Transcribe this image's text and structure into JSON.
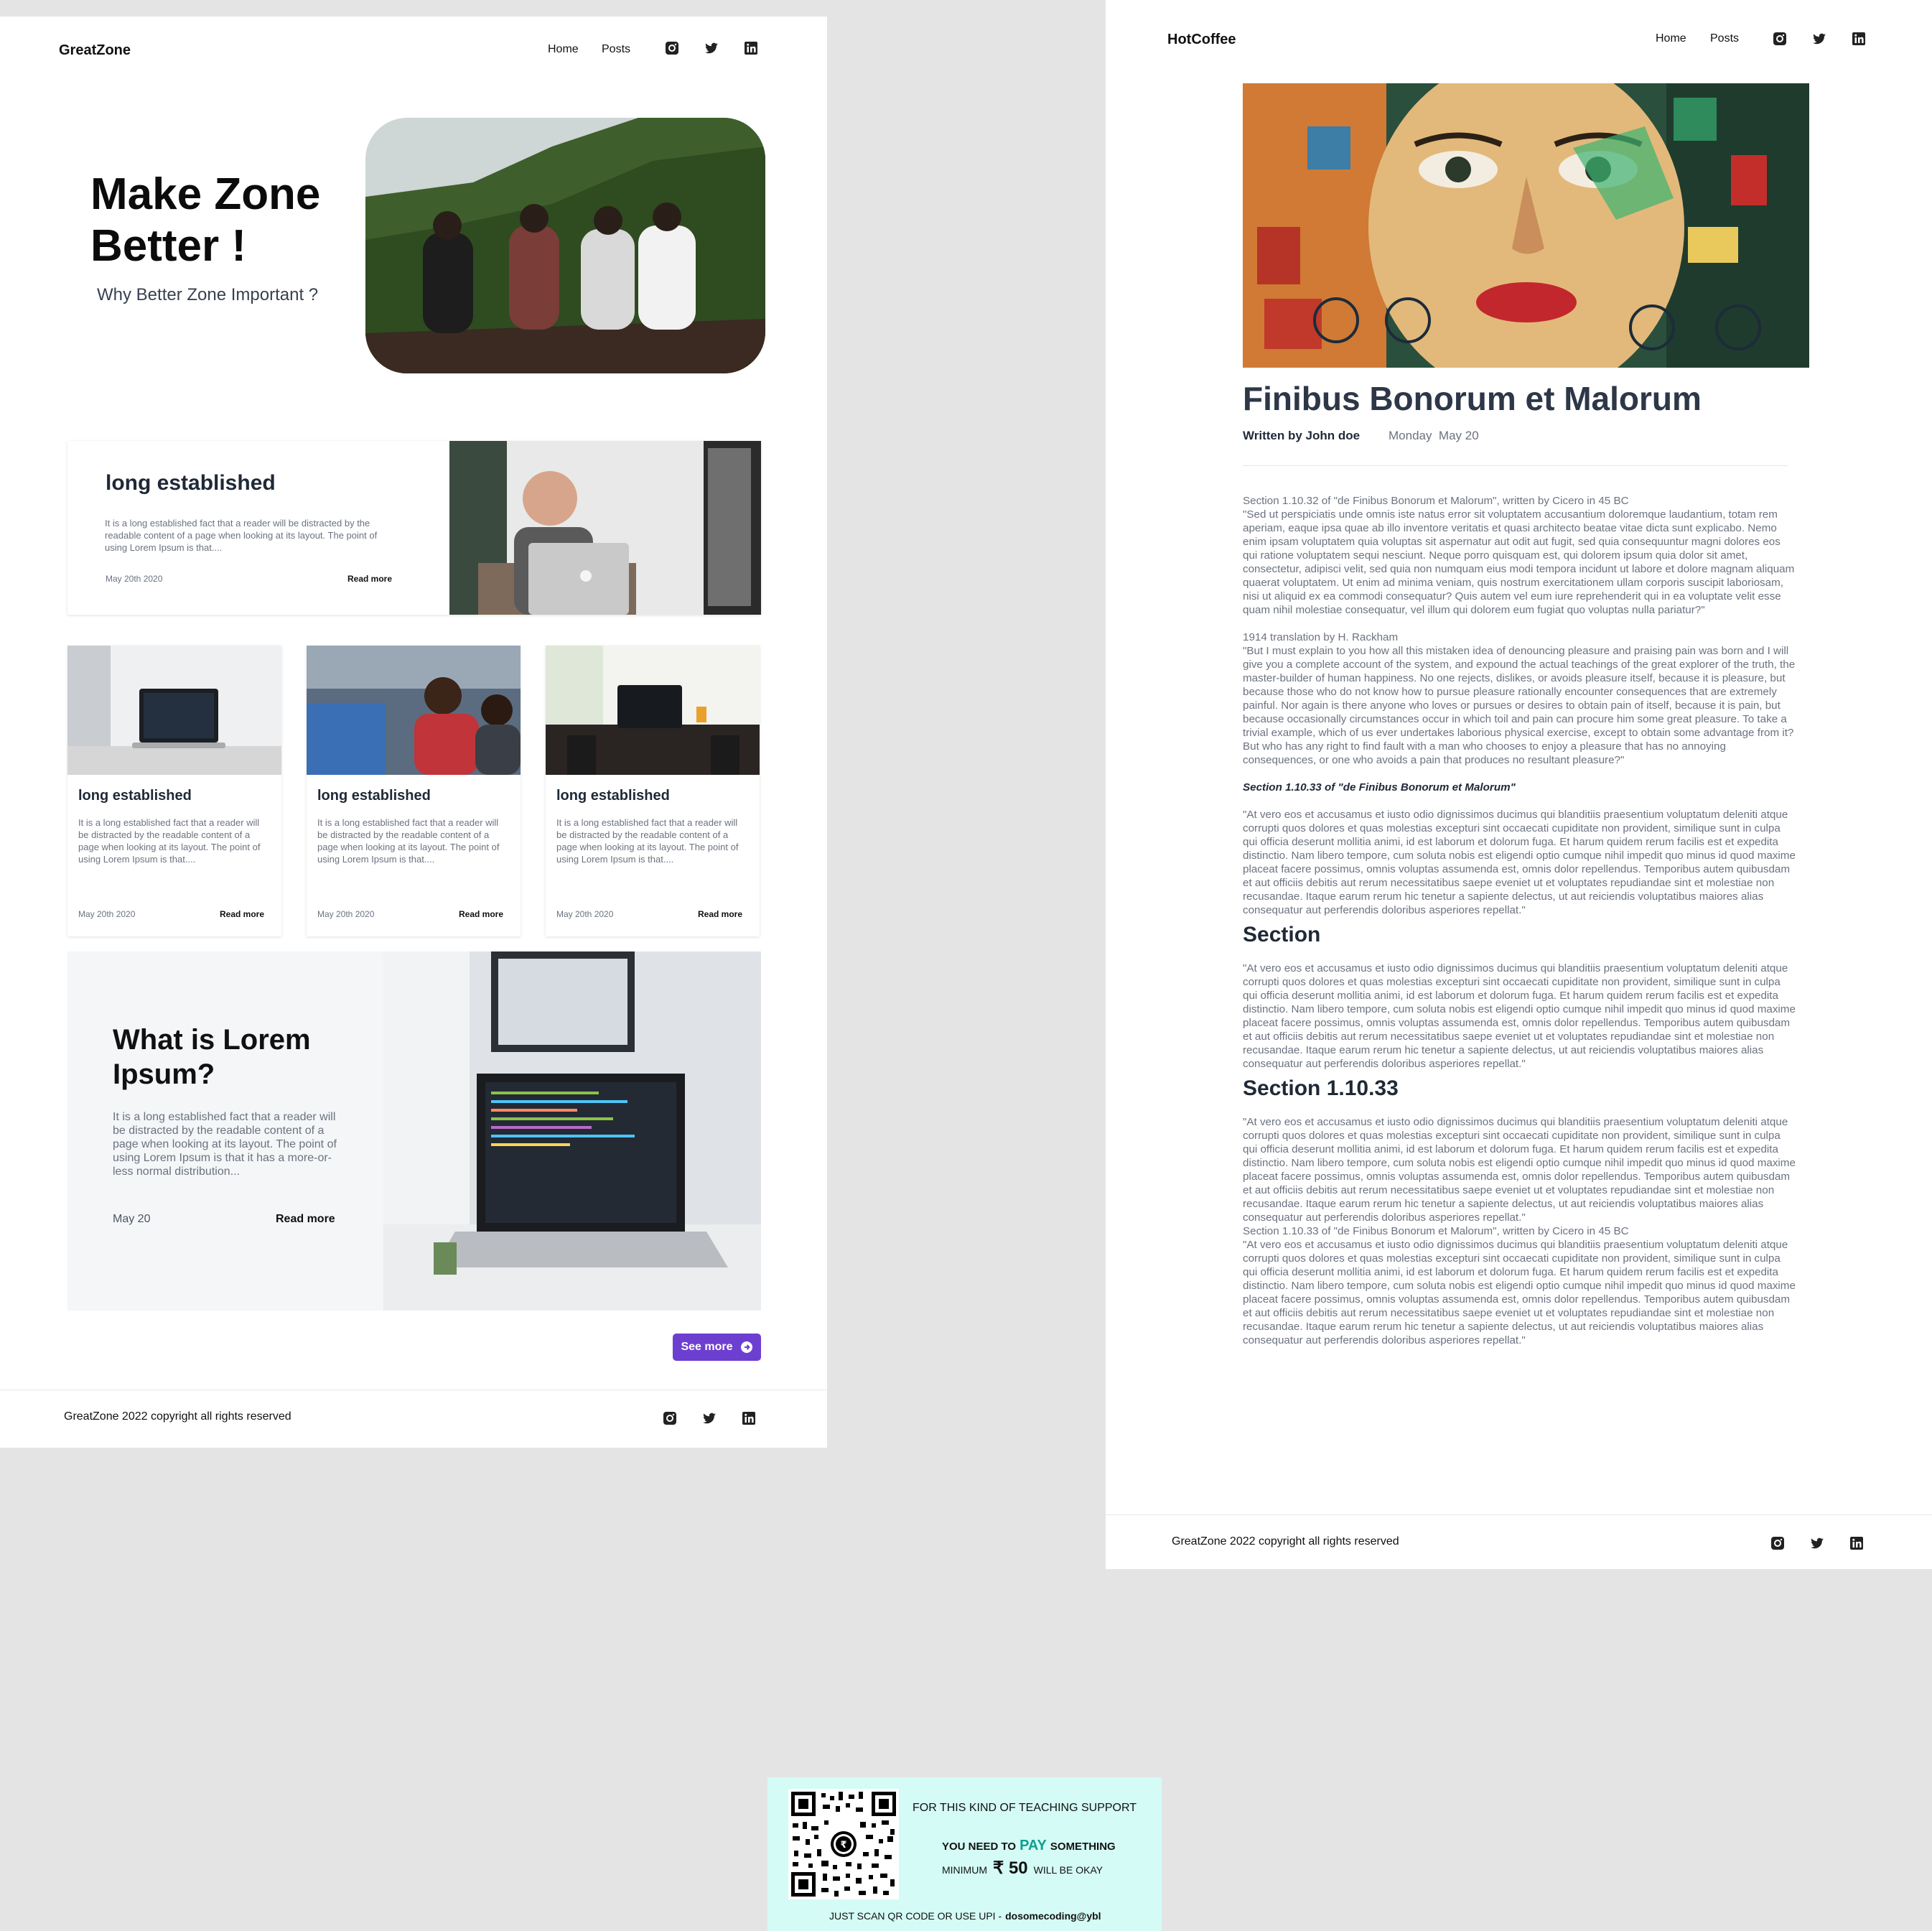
{
  "left_page": {
    "brand": "GreatZone",
    "nav": {
      "home": "Home",
      "posts": "Posts"
    },
    "social": [
      "instagram-icon",
      "twitter-icon",
      "linkedin-icon"
    ],
    "hero": {
      "title_line1": "Make Zone",
      "title_line2": "Better !",
      "subtitle": "Why Better Zone Important ?"
    },
    "featured": {
      "title": "long established",
      "text": "It is a long established fact that a reader will be distracted by the readable content of a page when looking at its layout. The point of using Lorem Ipsum is that....",
      "date": "May 20th 2020",
      "read_more": "Read more"
    },
    "cards": [
      {
        "title": "long established",
        "text": "It is a long established fact that a reader will be distracted by the readable content of a page when looking at its layout. The point of using Lorem Ipsum is that....",
        "date": "May 20th 2020",
        "read_more": "Read more"
      },
      {
        "title": "long established",
        "text": "It is a long established fact that a reader will be distracted by the readable content of a page when looking at its layout. The point of using Lorem Ipsum is that....",
        "date": "May 20th 2020",
        "read_more": "Read more"
      },
      {
        "title": "long established",
        "text": "It is a long established fact that a reader will be distracted by the readable content of a page when looking at its layout. The point of using Lorem Ipsum is that....",
        "date": "May 20th 2020",
        "read_more": "Read more"
      }
    ],
    "lorem": {
      "title_line1": "What is Lorem",
      "title_line2": "Ipsum?",
      "text": "It is a long established fact that a reader will be distracted by the readable content of a page when looking at its layout. The point of using Lorem Ipsum is that it has a more-or-less normal distribution...",
      "date": "May 20",
      "read_more": "Read more"
    },
    "see_more": "See more",
    "footer": "GreatZone 2022 copyright all rights reserved",
    "accent": "#6d3fd1"
  },
  "right_page": {
    "brand": "HotCoffee",
    "nav": {
      "home": "Home",
      "posts": "Posts"
    },
    "article": {
      "title": "Finibus Bonorum et Malorum",
      "author": "Written by John doe",
      "date": "Monday  May 20",
      "p1_head": "Section 1.10.32 of \"de Finibus Bonorum et Malorum\", written by Cicero in 45 BC",
      "p1": "\"Sed ut perspiciatis unde omnis iste natus error sit voluptatem accusantium doloremque laudantium, totam rem aperiam, eaque ipsa quae ab illo inventore veritatis et quasi architecto beatae vitae dicta sunt explicabo. Nemo enim ipsam voluptatem quia voluptas sit aspernatur aut odit aut fugit, sed quia consequuntur magni dolores eos qui ratione voluptatem sequi nesciunt. Neque porro quisquam est, qui dolorem ipsum quia dolor sit amet, consectetur, adipisci velit, sed quia non numquam eius modi tempora incidunt ut labore et dolore magnam aliquam quaerat voluptatem. Ut enim ad minima veniam, quis nostrum exercitationem ullam corporis suscipit laboriosam, nisi ut aliquid ex ea commodi consequatur? Quis autem vel eum iure reprehenderit qui in ea voluptate velit esse quam nihil molestiae consequatur, vel illum qui dolorem eum fugiat quo voluptas nulla pariatur?\"",
      "p2_head": "1914 translation by H. Rackham",
      "p2": "\"But I must explain to you how all this mistaken idea of denouncing pleasure and praising pain was born and I will give you a complete account of the system, and expound the actual teachings of the great explorer of the truth, the master-builder of human happiness. No one rejects, dislikes, or avoids pleasure itself, because it is pleasure, but because those who do not know how to pursue pleasure rationally encounter consequences that are extremely painful. Nor again is there anyone who loves or pursues or desires to obtain pain of itself, because it is pain, but because occasionally circumstances occur in which toil and pain can procure him some great pleasure. To take a trivial example, which of us ever undertakes laborious physical exercise, except to obtain some advantage from it? But who has any right to find fault with a man who chooses to enjoy a pleasure that has no annoying consequences, or one who avoids a pain that produces no resultant pleasure?\"",
      "italic_head": "Section 1.10.33 of \"de Finibus Bonorum et Malorum\"",
      "p3": "\"At vero eos et accusamus et iusto odio dignissimos ducimus qui blanditiis praesentium voluptatum deleniti atque corrupti quos dolores et quas molestias excepturi sint occaecati cupiditate non provident, similique sunt in culpa qui officia deserunt mollitia animi, id est laborum et dolorum fuga. Et harum quidem rerum facilis est et expedita distinctio. Nam libero tempore, cum soluta nobis est eligendi optio cumque nihil impedit quo minus id quod maxime placeat facere possimus, omnis voluptas assumenda est, omnis dolor repellendus. Temporibus autem quibusdam et aut officiis debitis aut rerum necessitatibus saepe eveniet ut et voluptates repudiandae sint et molestiae non recusandae. Itaque earum rerum hic tenetur a sapiente delectus, ut aut reiciendis voluptatibus maiores alias consequatur aut perferendis doloribus asperiores repellat.\"",
      "h_section": "Section",
      "p4": "\"At vero eos et accusamus et iusto odio dignissimos ducimus qui blanditiis praesentium voluptatum deleniti atque corrupti quos dolores et quas molestias excepturi sint occaecati cupiditate non provident, similique sunt in culpa qui officia deserunt mollitia animi, id est laborum et dolorum fuga. Et harum quidem rerum facilis est et expedita distinctio. Nam libero tempore, cum soluta nobis est eligendi optio cumque nihil impedit quo minus id quod maxime placeat facere possimus, omnis voluptas assumenda est, omnis dolor repellendus. Temporibus autem quibusdam et aut officiis debitis aut rerum necessitatibus saepe eveniet ut et voluptates repudiandae sint et molestiae non recusandae. Itaque earum rerum hic tenetur a sapiente delectus, ut aut reiciendis voluptatibus maiores alias consequatur aut perferendis doloribus asperiores repellat.\"",
      "h_section2": "Section 1.10.33",
      "p5": "\"At vero eos et accusamus et iusto odio dignissimos ducimus qui blanditiis praesentium voluptatum deleniti atque corrupti quos dolores et quas molestias excepturi sint occaecati cupiditate non provident, similique sunt in culpa qui officia deserunt mollitia animi, id est laborum et dolorum fuga. Et harum quidem rerum facilis est et expedita distinctio. Nam libero tempore, cum soluta nobis est eligendi optio cumque nihil impedit quo minus id quod maxime placeat facere possimus, omnis voluptas assumenda est, omnis dolor repellendus. Temporibus autem quibusdam et aut officiis debitis aut rerum necessitatibus saepe eveniet ut et voluptates repudiandae sint et molestiae non recusandae. Itaque earum rerum hic tenetur a sapiente delectus, ut aut reiciendis voluptatibus maiores alias consequatur aut perferendis doloribus asperiores repellat.\"",
      "p6_head": "Section 1.10.33 of \"de Finibus Bonorum et Malorum\", written by Cicero in 45 BC",
      "p6": "\"At vero eos et accusamus et iusto odio dignissimos ducimus qui blanditiis praesentium voluptatum deleniti atque corrupti quos dolores et quas molestias excepturi sint occaecati cupiditate non provident, similique sunt in culpa qui officia deserunt mollitia animi, id est laborum et dolorum fuga. Et harum quidem rerum facilis est et expedita distinctio. Nam libero tempore, cum soluta nobis est eligendi optio cumque nihil impedit quo minus id quod maxime placeat facere possimus, omnis voluptas assumenda est, omnis dolor repellendus. Temporibus autem quibusdam et aut officiis debitis aut rerum necessitatibus saepe eveniet ut et voluptates repudiandae sint et molestiae non recusandae. Itaque earum rerum hic tenetur a sapiente delectus, ut aut reiciendis voluptatibus maiores alias consequatur aut perferendis doloribus asperiores repellat.\""
    },
    "footer": "GreatZone 2022 copyright all rights reserved"
  },
  "pay_box": {
    "line1": "FOR THIS KIND OF TEACHING SUPPORT",
    "line2_a": "YOU NEED TO",
    "line2_pay": "PAY",
    "line2_b": "SOMETHING",
    "line3_a": "MINIMUM",
    "line3_amount": "₹ 50",
    "line3_b": "WILL BE OKAY",
    "line4_a": "JUST SCAN QR CODE OR USE UPI -",
    "upi_id": "dosomecoding@ybl",
    "pay_color": "#0f9e8f"
  }
}
